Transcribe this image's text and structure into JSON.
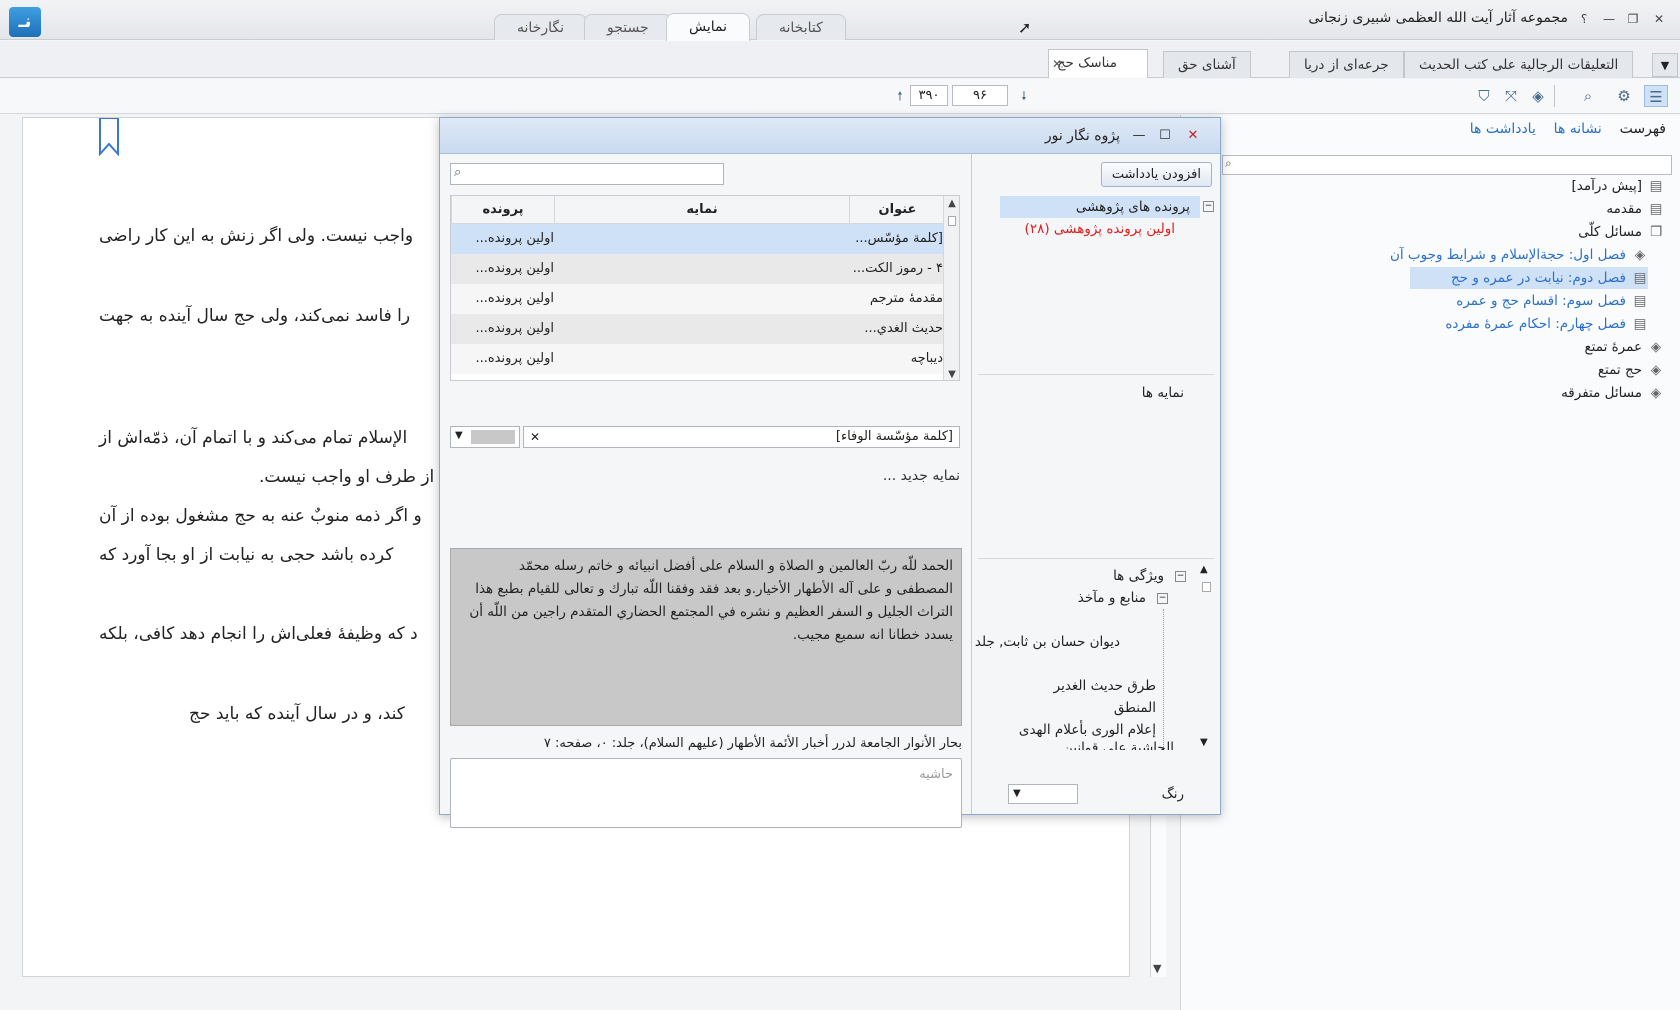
{
  "titlebar": {
    "app_title": "مجموعه آثار آیت الله العظمی شبیری زنجانی",
    "logo_glyph": "نـ",
    "tabs": [
      {
        "label": "کتابخانه"
      },
      {
        "label": "نمایش"
      },
      {
        "label": "جستجو"
      },
      {
        "label": "نگارخانه"
      }
    ],
    "help": "؟"
  },
  "doc_tabs": [
    {
      "label": "التعلیقات الرجالیة علی کتب الحدیث"
    },
    {
      "label": "جرعه‌ای از دریا"
    },
    {
      "label": "آشنای حق"
    },
    {
      "label": "مناسک حج"
    }
  ],
  "toolbar": {
    "page_current": "۹۶",
    "page_total": "۳۹۰"
  },
  "document": {
    "lines": [
      "واجب نیست. ولی اگر زنش به این کار راضی",
      "را فاسد نمی‌کند، ولی حج سال آینده به جهت",
      "الإسلام تمام می‌کند و با اتمام آن، ذمّه‌اش از",
      "از طرف او واجب نیست.",
      "و اگر ذمه منوبٌ عنه به حج مشغول بوده از آن",
      "کرده باشد حجی به نیابت از او بجا آورد که",
      "د که وظیفهٔ فعلی‌اش را انجام دهد کافی، بلکه",
      "کند، و در سال آینده که باید حج"
    ]
  },
  "right_panel": {
    "tabs": [
      "فهرست",
      "نشانه ها",
      "یادداشت ها"
    ],
    "tree": [
      {
        "label": "[پیش درآمد]",
        "link": false
      },
      {
        "label": "مقدمه",
        "link": false
      },
      {
        "label": "مسائل کلّی",
        "link": false
      },
      {
        "label": "فصل اول: حجةالإسلام و شرایط وجوب آن",
        "link": true
      },
      {
        "label": "فصل دوم: نیابت در عمره و حج",
        "link": true
      },
      {
        "label": "فصل سوم: اقسام حج و عمره",
        "link": true
      },
      {
        "label": "فصل چهارم: احکام عمرهٔ مفرده",
        "link": true
      },
      {
        "label": "عمرهٔ تمتع",
        "link": false
      },
      {
        "label": "حج تمتع",
        "link": false
      },
      {
        "label": "مسائل متفرقه",
        "link": false
      }
    ]
  },
  "modal": {
    "title": "پژوه نگار نور",
    "add_note_label": "افزودن یادداشت",
    "grid": {
      "headers": [
        "عنوان",
        "نمایه",
        "پرونده پژوهشی"
      ],
      "rows": [
        {
          "title": "[كلمة مؤسّس...",
          "index": "",
          "file": "اولین پرونده..."
        },
        {
          "title": "۴ - رموز الكت...",
          "index": "",
          "file": "اولین پرونده..."
        },
        {
          "title": "مقدمهٔ مترجم",
          "index": "",
          "file": "اولین پرونده..."
        },
        {
          "title": "حديث الغدي...",
          "index": "",
          "file": "اولین پرونده..."
        },
        {
          "title": "دیباچه",
          "index": "",
          "file": "اولین پرونده..."
        }
      ]
    },
    "tag_value": "[كلمة مؤسّسة الوفاء]",
    "new_index_label": "نمایه جدید ...",
    "text_content": "الحمد للّه ربّ العالمين و الصلاة و السلام على أفضل انبيائه و خاتم رسله محمّد المصطفى و على آله الأطهار الأخيار.و بعد فقد وفقنا اللّه تبارك و تعالى للقيام بطبع هذا التراث الجليل و السفر العظيم و نشره في المجتمع الحضاري المتقدم راجين من اللّه أن يسدد خطانا انه سميع مجيب.",
    "source": "بحار الأنوار الجامعة لدرر أخبار الأئمة الأطهار (علیهم السلام)، جلد: ۰، صفحه: ۷",
    "margin_placeholder": "حاشیه",
    "research_files_label": "پرونده های پژوهشی",
    "first_file_label": "اولین پرونده پژوهشی (۲۸)",
    "indexes_label": "نمایه ها",
    "properties_label": "ویژگی ها",
    "sources_label": "منابع و مآخذ",
    "sources": [
      "دیوان حسان بن ثابت, جلد",
      "طرق حديث الغدير",
      "المنطق",
      "إعلام الورى بأعلام الهدى",
      "الحاشية على قوانين"
    ],
    "color_label": "رنگ"
  },
  "colors": {
    "accent": "#2a6fc9",
    "first_file": "#e02020"
  }
}
